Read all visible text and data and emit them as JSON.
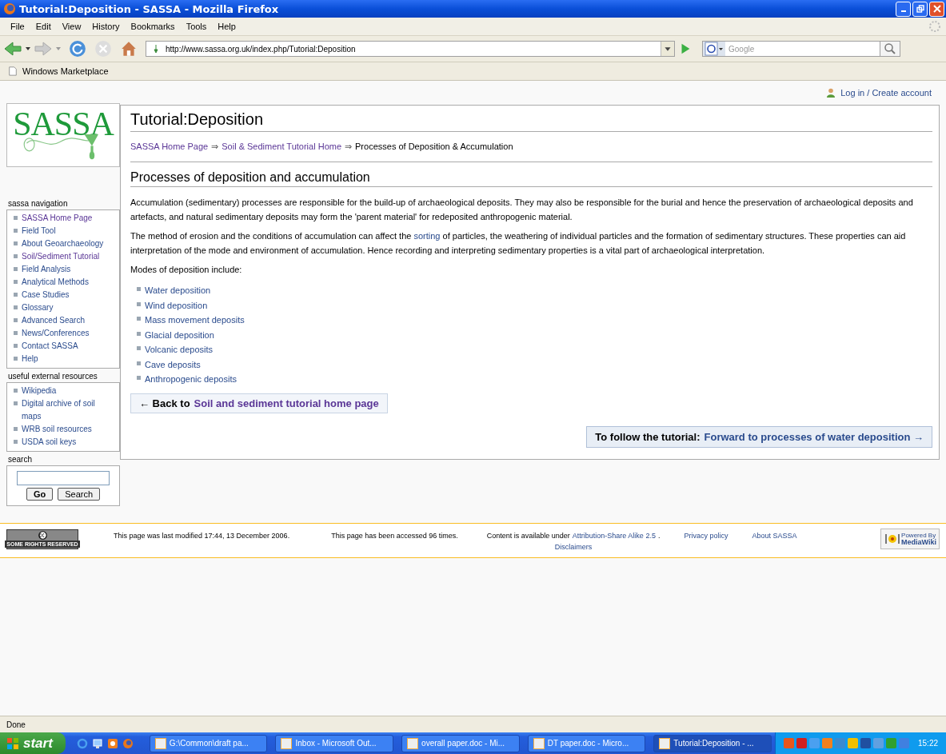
{
  "window": {
    "title": "Tutorial:Deposition - SASSA - Mozilla Firefox"
  },
  "menu": [
    "File",
    "Edit",
    "View",
    "History",
    "Bookmarks",
    "Tools",
    "Help"
  ],
  "address": {
    "value": "http://www.sassa.org.uk/index.php/Tutorial:Deposition"
  },
  "search_box": {
    "placeholder": "Google"
  },
  "bookmarks": [
    "Windows Marketplace"
  ],
  "user_link": "Log in / Create account",
  "logo": {
    "text": "SASSA"
  },
  "sidebar": [
    {
      "title": "sassa navigation",
      "items": [
        {
          "label": "SASSA Home Page",
          "visited": true
        },
        {
          "label": "Field Tool",
          "visited": false
        },
        {
          "label": "About Geoarchaeology",
          "visited": false
        },
        {
          "label": "Soil/Sediment Tutorial",
          "visited": true
        },
        {
          "label": "Field Analysis",
          "visited": false
        },
        {
          "label": "Analytical Methods",
          "visited": false
        },
        {
          "label": "Case Studies",
          "visited": false
        },
        {
          "label": "Glossary",
          "visited": false
        },
        {
          "label": "Advanced Search",
          "visited": false
        },
        {
          "label": "News/Conferences",
          "visited": false
        },
        {
          "label": "Contact SASSA",
          "visited": false
        },
        {
          "label": "Help",
          "visited": false
        }
      ]
    },
    {
      "title": "useful external resources",
      "items": [
        {
          "label": "Wikipedia",
          "visited": false
        },
        {
          "label": "Digital archive of soil maps",
          "visited": false
        },
        {
          "label": "WRB soil resources",
          "visited": false
        },
        {
          "label": "USDA soil keys",
          "visited": false
        }
      ]
    }
  ],
  "search": {
    "title": "search",
    "buttons": [
      "Go",
      "Search"
    ]
  },
  "article": {
    "title": "Tutorial:Deposition",
    "breadcrumb": [
      {
        "label": "SASSA Home Page",
        "link": true
      },
      {
        "label": "Soil & Sediment Tutorial Home",
        "link": true
      },
      {
        "label": "Processes of Deposition & Accumulation",
        "link": false
      }
    ],
    "separator": "⇒",
    "heading": "Processes of deposition and accumulation",
    "para1": "Accumulation (sedimentary) processes are responsible for the build-up of archaeological deposits. They may also be responsible for the burial and hence the preservation of archaeological deposits and artefacts, and natural sedimentary deposits may form the 'parent material' for redeposited anthropogenic material.",
    "para2_before": "The method of erosion and the conditions of accumulation can affect the",
    "para2_link": "sorting",
    "para2_after": "of particles, the weathering of individual particles and the formation of sedimentary structures. These properties can aid interpretation of the mode and environment of accumulation. Hence recording and interpreting sedimentary properties is a vital part of archaeological interpretation.",
    "modes_intro": "Modes of deposition include:",
    "modes": [
      "Water deposition",
      "Wind deposition",
      "Mass movement deposits",
      "Glacial deposition",
      "Volcanic deposits",
      "Cave deposits",
      "Anthropogenic deposits"
    ],
    "back": {
      "prefix": "← Back to",
      "link": "Soil and sediment tutorial home page"
    },
    "forward": {
      "prefix": "To follow the tutorial:",
      "link": "Forward to processes of water deposition →"
    }
  },
  "footer": {
    "cc_badge": "SOME RIGHTS RESERVED",
    "modified": "This page was last modified 17:44, 13 December 2006.",
    "accessed": "This page has been accessed 96 times.",
    "content_prefix": "Content is available under",
    "license": "Attribution-Share Alike 2.5",
    "content_suffix": ".",
    "disclaimers": "Disclaimers",
    "privacy": "Privacy policy",
    "about": "About SASSA",
    "powered_small": "Powered By",
    "powered_big": "MediaWiki"
  },
  "status_bar": "Done",
  "taskbar": {
    "start": "start",
    "tasks": [
      {
        "label": "G:\\Common\\draft pa...",
        "selected": false
      },
      {
        "label": "Inbox - Microsoft Out...",
        "selected": false
      },
      {
        "label": "overall paper.doc - Mi...",
        "selected": false
      },
      {
        "label": "DT paper.doc - Micro...",
        "selected": false
      },
      {
        "label": "Tutorial:Deposition - ...",
        "selected": true
      }
    ],
    "clock": "15:22"
  }
}
